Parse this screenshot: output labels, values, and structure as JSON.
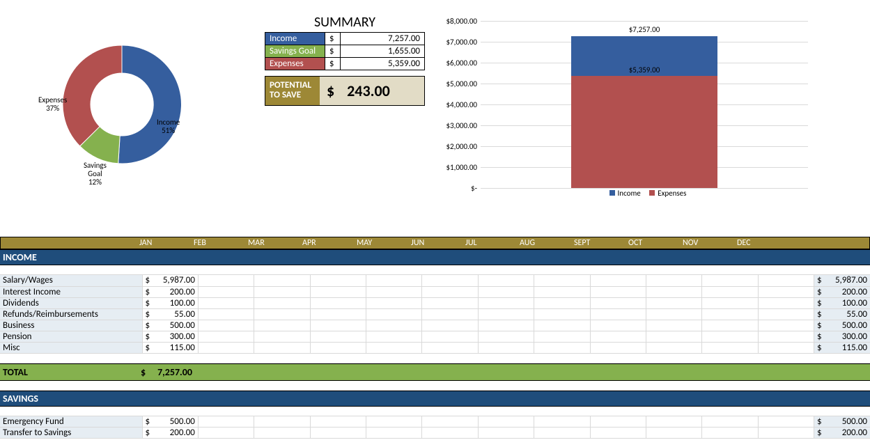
{
  "summary": {
    "title": "SUMMARY",
    "rows": [
      {
        "label": "Income",
        "cls": "lg-income",
        "curr": "$",
        "amount": "7,257.00"
      },
      {
        "label": "Savings Goal",
        "cls": "lg-savings",
        "curr": "$",
        "amount": "1,655.00"
      },
      {
        "label": "Expenses",
        "cls": "lg-expenses",
        "curr": "$",
        "amount": "5,359.00"
      }
    ],
    "potential_label": "POTENTIAL TO SAVE",
    "potential_curr": "$",
    "potential_amount": "243.00"
  },
  "chart_data": [
    {
      "type": "pie",
      "title": "",
      "series": [
        {
          "name": "Income",
          "value": 51,
          "color": "#355e9e",
          "label": "Income\n51%"
        },
        {
          "name": "Savings Goal",
          "value": 12,
          "color": "#85b14e",
          "label": "Savings\nGoal\n12%"
        },
        {
          "name": "Expenses",
          "value": 37,
          "color": "#b2504f",
          "label": "Expenses\n37%"
        }
      ]
    },
    {
      "type": "bar",
      "stacked": true,
      "categories": [
        ""
      ],
      "series": [
        {
          "name": "Expenses",
          "values": [
            5359.0
          ],
          "color": "#b2504f"
        },
        {
          "name": "Income",
          "values": [
            7257.0
          ],
          "color": "#355e9e",
          "top_label": "$7,257.00",
          "mid_label": "$5,359.00"
        }
      ],
      "ylim": [
        0,
        8000
      ],
      "yticks": [
        "$-",
        "$1,000.00",
        "$2,000.00",
        "$3,000.00",
        "$4,000.00",
        "$5,000.00",
        "$6,000.00",
        "$7,000.00",
        "$8,000.00"
      ],
      "legend": [
        "Income",
        "Expenses"
      ]
    }
  ],
  "months": [
    "JAN",
    "FEB",
    "MAR",
    "APR",
    "MAY",
    "JUN",
    "JUL",
    "AUG",
    "SEPT",
    "OCT",
    "NOV",
    "DEC"
  ],
  "sections": {
    "income": {
      "title": "INCOME",
      "rows": [
        {
          "label": "Salary/Wages",
          "jan": "5,987.00",
          "total": "5,987.00"
        },
        {
          "label": "Interest Income",
          "jan": "200.00",
          "total": "200.00"
        },
        {
          "label": "Dividends",
          "jan": "100.00",
          "total": "100.00"
        },
        {
          "label": "Refunds/Reimbursements",
          "jan": "55.00",
          "total": "55.00"
        },
        {
          "label": "Business",
          "jan": "500.00",
          "total": "500.00"
        },
        {
          "label": "Pension",
          "jan": "300.00",
          "total": "300.00"
        },
        {
          "label": "Misc",
          "jan": "115.00",
          "total": "115.00"
        }
      ],
      "total_label": "TOTAL",
      "total_jan": "7,257.00"
    },
    "savings": {
      "title": "SAVINGS",
      "rows": [
        {
          "label": "Emergency Fund",
          "jan": "500.00",
          "total": "500.00"
        },
        {
          "label": "Transfer to Savings",
          "jan": "200.00",
          "total": "200.00"
        }
      ]
    }
  }
}
